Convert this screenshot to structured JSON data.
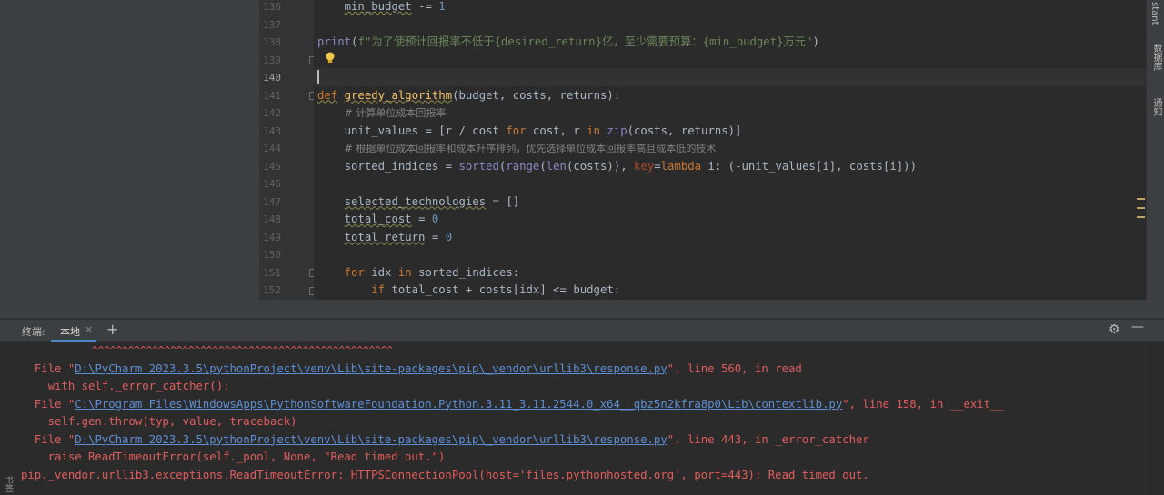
{
  "editor": {
    "line_numbers": [
      "136",
      "137",
      "138",
      "139",
      "140",
      "141",
      "142",
      "143",
      "144",
      "145",
      "146",
      "147",
      "148",
      "149",
      "150",
      "151",
      "152"
    ],
    "current_line": "140"
  },
  "code": {
    "l136_var": "min_budget",
    "l136_op": " -= ",
    "l136_num": "1",
    "l138_fn": "print",
    "l138_open": "(",
    "l138_str1": "f\"为了使预计回报率不低于",
    "l138_expr1": "{desired_return}",
    "l138_str2": "亿，至少需要预算：",
    "l138_expr2": "{min_budget}",
    "l138_str3": "万元\"",
    "l138_close": ")",
    "l141_kw": "def",
    "l141_name": "greedy_algorithm",
    "l141_sig": "(budget, costs, returns):",
    "l142_cmt": "# 计算单位成本回报率",
    "l143_a": "unit_values = [r / cost ",
    "l143_for": "for",
    "l143_b": " cost, r ",
    "l143_in": "in",
    "l143_sp": " ",
    "l143_zip": "zip",
    "l143_c": "(costs, returns)]",
    "l144_cmt": "# 根据单位成本回报率和成本升序排列，优先选择单位成本回报率高且成本低的技术",
    "l145_a": "sorted_indices = ",
    "l145_sorted": "sorted",
    "l145_p1": "(",
    "l145_range": "range",
    "l145_p2": "(",
    "l145_len": "len",
    "l145_b": "(costs)), ",
    "l145_key": "key",
    "l145_eq": "=",
    "l145_lambda": "lambda",
    "l145_c": " i: (-unit_values[i], costs[i]))",
    "l147_var": "selected_technologies",
    "l147_rest": " = []",
    "l148_var": "total_cost",
    "l148_op": " = ",
    "l148_num": "0",
    "l149_var": "total_return",
    "l149_op": " = ",
    "l149_num": "0",
    "l151_for": "for",
    "l151_a": " idx ",
    "l151_in": "in",
    "l151_b": " sorted_indices:",
    "l152_if": "if",
    "l152_a": " total_cost + costs[idx] <= budget:"
  },
  "right_strip": {
    "item1": "stant",
    "item2": "数据库",
    "item3": "通知"
  },
  "terminal": {
    "header_label": "终端:",
    "tab_label": "本地",
    "tab_close": "×",
    "add_tab": "+",
    "settings_icon": "⚙",
    "minimize_icon": "—",
    "bottom_left": "书签",
    "line_caret": "^^^^^^^^^^^^^^^^^^^^^^^^^^^^^^^^^^^^^^^^^^^^^^^^^^",
    "l1_pre": "  File \"",
    "l1_link": "D:\\PyCharm 2023.3.5\\pythonProject\\venv\\Lib\\site-packages\\pip\\_vendor\\urllib3\\response.py",
    "l1_post": "\", line 560, in read",
    "l2": "    with self._error_catcher():",
    "l3_pre": "  File \"",
    "l3_link": "C:\\Program Files\\WindowsApps\\PythonSoftwareFoundation.Python.3.11_3.11.2544.0_x64__qbz5n2kfra8p0\\Lib\\contextlib.py",
    "l3_post": "\", line 158, in __exit__",
    "l4": "    self.gen.throw(typ, value, traceback)",
    "l5_pre": "  File \"",
    "l5_link": "D:\\PyCharm 2023.3.5\\pythonProject\\venv\\Lib\\site-packages\\pip\\_vendor\\urllib3\\response.py",
    "l5_post": "\", line 443, in _error_catcher",
    "l6": "    raise ReadTimeoutError(self._pool, None, \"Read timed out.\")",
    "l7": "pip._vendor.urllib3.exceptions.ReadTimeoutError: HTTPSConnectionPool(host='files.pythonhosted.org', port=443): Read timed out."
  }
}
